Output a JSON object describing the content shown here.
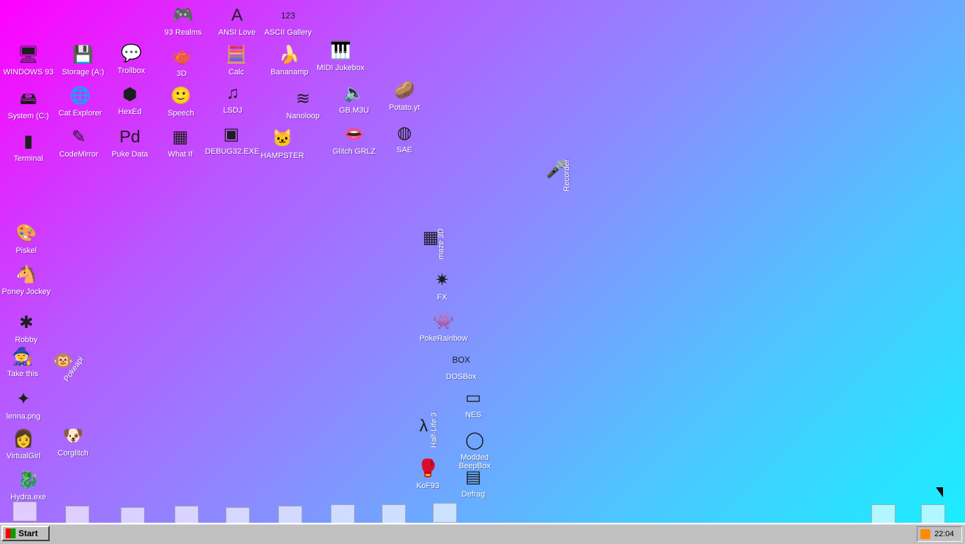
{
  "desktop": {
    "icons": [
      {
        "id": "93-realms",
        "label": "93 Realms",
        "symbol": "🎮"
      },
      {
        "id": "ansi-love",
        "label": "ANSI Love",
        "symbol": "A"
      },
      {
        "id": "ascii-gallery",
        "label": "ASCII Gallery",
        "symbol": "123"
      },
      {
        "id": "windows93",
        "label": "WINDOWS 93",
        "symbol": "🖥"
      },
      {
        "id": "storage-a",
        "label": "Storage (A:)",
        "symbol": "💾"
      },
      {
        "id": "trollbox",
        "label": "Trollbox",
        "symbol": "💬"
      },
      {
        "id": "three-d",
        "label": "3D",
        "symbol": "🫖"
      },
      {
        "id": "calc",
        "label": "Calc",
        "symbol": "🧮"
      },
      {
        "id": "bananamp",
        "label": "Bananamp",
        "symbol": "🍌"
      },
      {
        "id": "midi-jukebox",
        "label": "MIDI Jukebox",
        "symbol": "🎹"
      },
      {
        "id": "system-c",
        "label": "System (C:)",
        "symbol": "🖴"
      },
      {
        "id": "cat-explorer",
        "label": "Cat Explorer",
        "symbol": "🌐"
      },
      {
        "id": "hexed",
        "label": "HexEd",
        "symbol": "⬢"
      },
      {
        "id": "speech",
        "label": "Speech",
        "symbol": "🙂"
      },
      {
        "id": "lsdj",
        "label": "LSDJ",
        "symbol": "♫"
      },
      {
        "id": "nanoloop",
        "label": "Nanoloop",
        "symbol": "≋"
      },
      {
        "id": "gbm3u",
        "label": "GB.M3U",
        "symbol": "🔈"
      },
      {
        "id": "potato",
        "label": "Potato.yt",
        "symbol": "🥔"
      },
      {
        "id": "terminal",
        "label": "Terminal",
        "symbol": "▮"
      },
      {
        "id": "codemirror",
        "label": "CodeMirror",
        "symbol": "✎"
      },
      {
        "id": "puke-data",
        "label": "Puke Data",
        "symbol": "Pd"
      },
      {
        "id": "what-if",
        "label": "What If",
        "symbol": "▦"
      },
      {
        "id": "debug",
        "label": "DEBUG32.EXE",
        "symbol": "▣"
      },
      {
        "id": "hampster",
        "label": "HAMPSTER",
        "symbol": "🐱"
      },
      {
        "id": "glitch-grlz",
        "label": "Glitch GRLZ",
        "symbol": "👄"
      },
      {
        "id": "sae",
        "label": "SAE",
        "symbol": "◍"
      },
      {
        "id": "recorder",
        "label": "Recorder",
        "symbol": "🎤"
      },
      {
        "id": "piskel",
        "label": "Piskel",
        "symbol": "🎨"
      },
      {
        "id": "poney-jockey",
        "label": "Poney Jockey",
        "symbol": "🐴"
      },
      {
        "id": "robby",
        "label": "Robby",
        "symbol": "✱"
      },
      {
        "id": "take-this",
        "label": "Take this",
        "symbol": "🧙"
      },
      {
        "id": "pokeapi",
        "label": "Pokeapi",
        "symbol": "🐵"
      },
      {
        "id": "lenna",
        "label": "lenna.png",
        "symbol": "✦"
      },
      {
        "id": "virtualgirl",
        "label": "VirtualGirl",
        "symbol": "👩"
      },
      {
        "id": "corglitch",
        "label": "Corglitch",
        "symbol": "🐶"
      },
      {
        "id": "hydra",
        "label": "Hydra.exe",
        "symbol": "🐉"
      },
      {
        "id": "maze3d",
        "label": "maze 3D",
        "symbol": "▦"
      },
      {
        "id": "fx",
        "label": "FX",
        "symbol": "✷"
      },
      {
        "id": "pokerainbow",
        "label": "PokeRainbow",
        "symbol": "👾"
      },
      {
        "id": "dosbox",
        "label": "DOSBox",
        "symbol": "BOX"
      },
      {
        "id": "nes",
        "label": "NES",
        "symbol": "▭"
      },
      {
        "id": "halflife3",
        "label": "Half-Life 3",
        "symbol": "λ"
      },
      {
        "id": "modded-beepbox",
        "label": "Modded BeepBox",
        "symbol": "◯"
      },
      {
        "id": "kof93",
        "label": "KoF93",
        "symbol": "🥊"
      },
      {
        "id": "defrag",
        "label": "Defrag",
        "symbol": "▤"
      }
    ]
  },
  "taskbar": {
    "start_label": "Start",
    "clock": "22:04"
  }
}
